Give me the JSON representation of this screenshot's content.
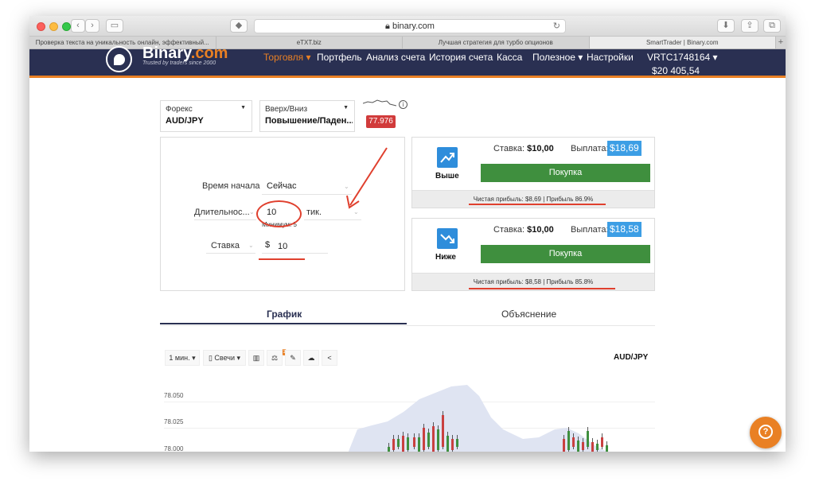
{
  "browser": {
    "url": "binary.com",
    "tabs": [
      {
        "title": "Проверка текста на уникальность онлайн, эффективный...",
        "active": false
      },
      {
        "title": "eTXT.biz",
        "active": false
      },
      {
        "title": "Лучшая стратегия для турбо опционов",
        "active": false
      },
      {
        "title": "SmartTrader | Binary.com",
        "active": true
      }
    ],
    "plus": "+"
  },
  "site": {
    "logo_main": "Binary",
    "logo_dot": ".com",
    "tagline": "Trusted by traders since 2000",
    "nav": [
      "Торговля ▾",
      "Портфель",
      "Анализ счета",
      "История счета",
      "Касса",
      "Полезное ▾",
      "Настройки"
    ],
    "account": "VRTC1748164 ▾",
    "balance": "$20 405,54"
  },
  "market": {
    "label": "Форекс",
    "value": "AUD/JPY"
  },
  "contract": {
    "label": "Вверх/Вниз",
    "value": "Повышение/Паден..."
  },
  "spot": "77.976",
  "info_icon": "i",
  "form": {
    "start_label": "Время начала",
    "start_value": "Сейчас",
    "duration_label": "Длительнос...",
    "duration_value": "10",
    "duration_unit": "тик.",
    "min_hint": "Минимум: 5",
    "stake_label": "Ставка",
    "currency": "$",
    "stake_value": "10"
  },
  "cards": [
    {
      "direction": "Выше",
      "stake_label": "Ставка:",
      "stake": "$10,00",
      "payout_label": "Выплата:",
      "payout": "$18,69",
      "buy": "Покупка",
      "footer": "Чистая прибыль: $8,69 | Прибыль 86.9%"
    },
    {
      "direction": "Ниже",
      "stake_label": "Ставка:",
      "stake": "$10,00",
      "payout_label": "Выплата:",
      "payout": "$18,58",
      "buy": "Покупка",
      "footer": "Чистая прибыль: $8,58 | Прибыль 85.8%"
    }
  ],
  "tabs": {
    "chart": "График",
    "explanation": "Объяснение"
  },
  "chart_toolbar": {
    "interval": "1 мин. ▾",
    "type": "▯ Свечи ▾",
    "indicator_badge": "1",
    "symbol": "AUD/JPY"
  },
  "chart_data": {
    "type": "candlestick",
    "title": "",
    "symbol": "AUD/JPY",
    "y_ticks": [
      "78.050",
      "78.025",
      "78.000"
    ],
    "ylim": [
      77.995,
      78.055
    ]
  },
  "help_icon": "?",
  "colors": {
    "header": "#2a3052",
    "accent": "#e98024",
    "buy": "#3f8f3e",
    "payout": "#3c9ee5",
    "spot": "#d13b3b",
    "annotation": "#e0402e"
  }
}
